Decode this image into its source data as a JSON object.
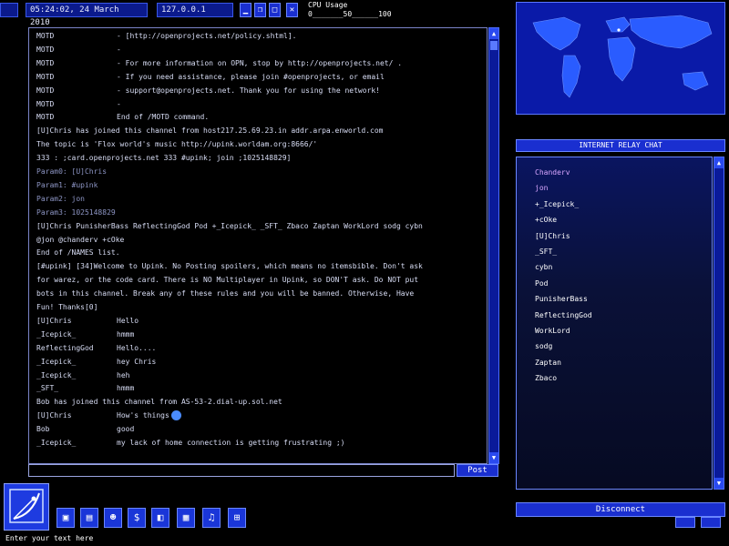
{
  "topbar": {
    "datetime": "05:24:02, 24 March 2010",
    "ip": "127.0.0.1",
    "cpu_title": "CPU Usage",
    "cpu_scale": "0_______50______100"
  },
  "chat": {
    "lines": [
      {
        "nick": "MOTD",
        "text": "- [http://openprojects.net/policy.shtml]."
      },
      {
        "nick": "MOTD",
        "text": "-"
      },
      {
        "nick": "MOTD",
        "text": "- For more information on OPN, stop by http://openprojects.net/ ."
      },
      {
        "nick": "MOTD",
        "text": "- If you need assistance, please join #openprojects, or email"
      },
      {
        "nick": "MOTD",
        "text": "- support@openprojects.net.  Thank you for using the network!"
      },
      {
        "nick": "MOTD",
        "text": "-"
      },
      {
        "nick": "MOTD",
        "text": "End of /MOTD command."
      },
      {
        "nick": "",
        "text": "[U]Chris has joined this channel from host217.25.69.23.in addr.arpa.enworld.com"
      },
      {
        "nick": "",
        "text": "The topic is 'Flox world's music http://upink.worldam.org:8666/'"
      },
      {
        "nick": "",
        "text": "333 : ;card.openprojects.net 333 #upink; join ;1025148829]"
      },
      {
        "nick": "",
        "text": "Param0: [U]Chris",
        "dim": true
      },
      {
        "nick": "",
        "text": "Param1: #upink",
        "dim": true
      },
      {
        "nick": "",
        "text": "Param2: jon",
        "dim": true
      },
      {
        "nick": "",
        "text": "Param3: 1025148829",
        "dim": true
      },
      {
        "nick": "",
        "text": "[U]Chris PunisherBass ReflectingGod Pod +_Icepick_ _SFT_ Zbaco Zaptan WorkLord sodg cybn"
      },
      {
        "nick": "",
        "text": "@jon @chanderv +cOke"
      },
      {
        "nick": "",
        "text": "End of /NAMES list."
      },
      {
        "nick": "",
        "text": "[#upink] [34]Welcome to Upink. No Posting spoilers, which means no itemsbible. Don't ask"
      },
      {
        "nick": "",
        "text": "for warez, or the code card. There is NO Multiplayer in Upink, so DON'T ask. Do NOT put"
      },
      {
        "nick": "",
        "text": "bots in this channel. Break any of these rules and you will be banned. Otherwise, Have"
      },
      {
        "nick": "",
        "text": "Fun! Thanks[0]"
      },
      {
        "nick": "[U]Chris",
        "text": "Hello"
      },
      {
        "nick": "_Icepick_",
        "text": "hmmm"
      },
      {
        "nick": "ReflectingGod",
        "text": "Hello...."
      },
      {
        "nick": "_Icepick_",
        "text": "hey Chris"
      },
      {
        "nick": "_Icepick_",
        "text": "heh"
      },
      {
        "nick": "_SFT_",
        "text": "hmmm"
      },
      {
        "nick": "",
        "text": "Bob has joined this channel from AS-53-2.dial-up.sol.net"
      },
      {
        "nick": "[U]Chris",
        "text": "How's things",
        "emoji": true
      },
      {
        "nick": "Bob",
        "text": "good"
      },
      {
        "nick": "_Icepick_",
        "text": "my lack of home connection is getting frustrating ;)"
      }
    ]
  },
  "input": {
    "placeholder": ""
  },
  "post_label": "Post",
  "footer_text": "Enter your text here",
  "irc_title": "INTERNET RELAY CHAT",
  "users": [
    {
      "name": "Chanderv",
      "hl": true
    },
    {
      "name": "jon",
      "hl": true
    },
    {
      "name": "+_Icepick_"
    },
    {
      "name": "+cOke"
    },
    {
      "name": "[U]Chris"
    },
    {
      "name": "_SFT_"
    },
    {
      "name": "cybn"
    },
    {
      "name": "Pod"
    },
    {
      "name": "PunisherBass"
    },
    {
      "name": "ReflectingGod"
    },
    {
      "name": "WorkLord"
    },
    {
      "name": "sodg"
    },
    {
      "name": "Zaptan"
    },
    {
      "name": "Zbaco"
    }
  ],
  "disconnect_label": "Disconnect",
  "colors": {
    "accent": "#1a2fd0",
    "highlight_user": "#d9a6ff"
  }
}
